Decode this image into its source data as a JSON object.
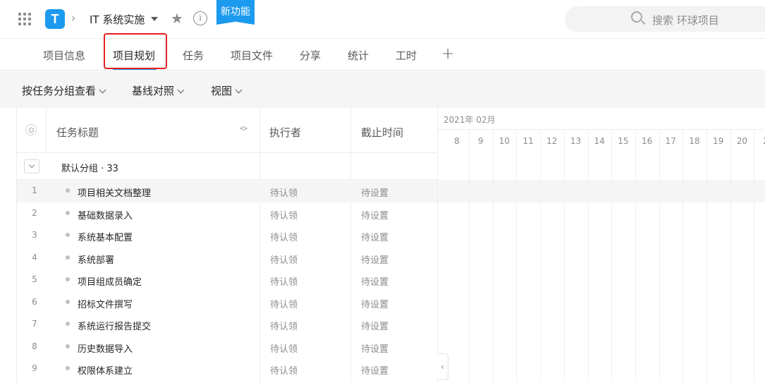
{
  "header": {
    "logo_text": "T",
    "project_name": "IT 系统实施",
    "new_feature_badge": "新功能",
    "search_placeholder": "搜索 环球项目"
  },
  "tabs": [
    {
      "label": "项目信息"
    },
    {
      "label": "项目规划",
      "active": true
    },
    {
      "label": "任务"
    },
    {
      "label": "项目文件"
    },
    {
      "label": "分享"
    },
    {
      "label": "统计"
    },
    {
      "label": "工时"
    }
  ],
  "toolbar": {
    "group_by": "按任务分组查看",
    "baseline": "基线对照",
    "view": "视图"
  },
  "table": {
    "headers": {
      "title": "任务标题",
      "assignee": "执行者",
      "deadline": "截止时间"
    },
    "group": {
      "label": "默认分组 · 33"
    },
    "rows": [
      {
        "num": "1",
        "title": "项目相关文档整理",
        "assignee": "待认领",
        "deadline": "待设置"
      },
      {
        "num": "2",
        "title": "基础数据录入",
        "assignee": "待认领",
        "deadline": "待设置"
      },
      {
        "num": "3",
        "title": "系统基本配置",
        "assignee": "待认领",
        "deadline": "待设置"
      },
      {
        "num": "4",
        "title": "系统部署",
        "assignee": "待认领",
        "deadline": "待设置"
      },
      {
        "num": "5",
        "title": "项目组成员确定",
        "assignee": "待认领",
        "deadline": "待设置"
      },
      {
        "num": "6",
        "title": "招标文件撰写",
        "assignee": "待认领",
        "deadline": "待设置"
      },
      {
        "num": "7",
        "title": "系统运行报告提交",
        "assignee": "待认领",
        "deadline": "待设置"
      },
      {
        "num": "8",
        "title": "历史数据导入",
        "assignee": "待认领",
        "deadline": "待设置"
      },
      {
        "num": "9",
        "title": "权限体系建立",
        "assignee": "待认领",
        "deadline": "待设置"
      }
    ]
  },
  "gantt": {
    "month_label": "2021年 02月",
    "days": [
      "8",
      "9",
      "10",
      "11",
      "12",
      "13",
      "14",
      "15",
      "16",
      "17",
      "18",
      "19",
      "20",
      "2"
    ]
  },
  "colors": {
    "accent": "#1b9aee",
    "highlight_box": "#e8201f"
  }
}
